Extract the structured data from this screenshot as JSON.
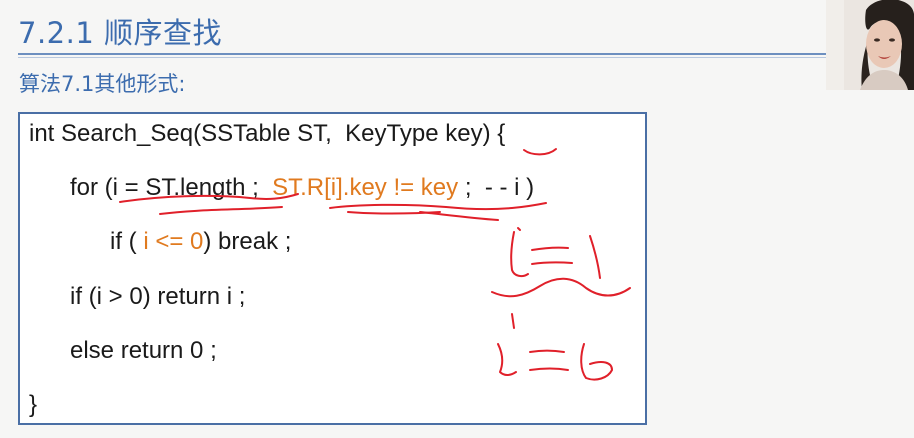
{
  "slide": {
    "section_title": "7.2.1 顺序查找",
    "subtitle": "算法7.1其他形式:"
  },
  "code": {
    "line1": "int Search_Seq(SSTable ST,  KeyType key) {",
    "line2_pre": "for (i = ST.length ;  ",
    "line2_hl": "ST.R[i].key != key",
    "line2_post": " ;  - - i )",
    "line3_pre": "if ( ",
    "line3_hl": "i <= 0",
    "line3_post": ") break ;",
    "line4": "if (i > 0) return i ;",
    "line5": "else return 0 ;",
    "line6": "}"
  },
  "colors": {
    "title": "#3c6cae",
    "code_highlight": "#e07a1f",
    "ink": "#e0202a",
    "box_border": "#4a6fa5"
  },
  "icons": {
    "webcam": "presenter-webcam"
  }
}
